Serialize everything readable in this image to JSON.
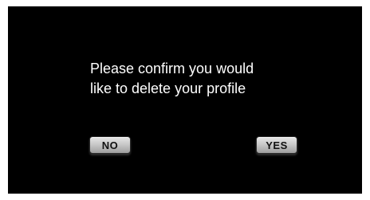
{
  "dialog": {
    "message_line1": "Please confirm you would",
    "message_line2": "like to delete your profile",
    "no_label": "NO",
    "yes_label": "YES"
  },
  "colors": {
    "screen_background": "#000000",
    "message_text": "#ffffff",
    "button_face": "#c9c9c9",
    "button_text": "#111111"
  }
}
